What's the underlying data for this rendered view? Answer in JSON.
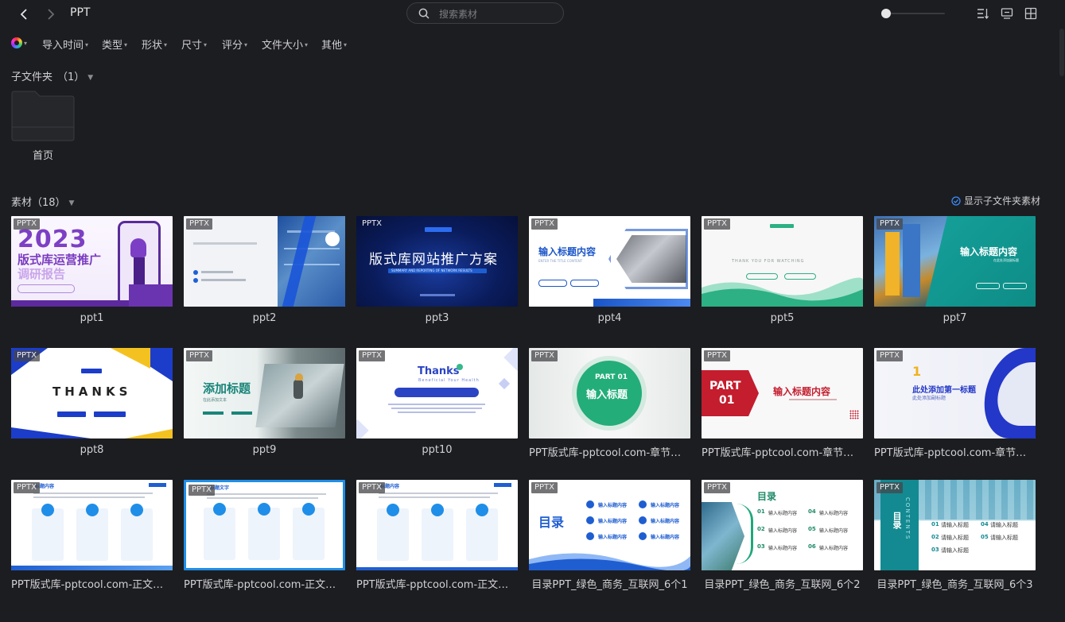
{
  "header": {
    "title": "PPT",
    "search_placeholder": "搜索素材"
  },
  "filters": [
    {
      "label": "导入时间"
    },
    {
      "label": "类型"
    },
    {
      "label": "形状"
    },
    {
      "label": "尺寸"
    },
    {
      "label": "评分"
    },
    {
      "label": "文件大小"
    },
    {
      "label": "其他"
    }
  ],
  "subfolders": {
    "heading": "子文件夹",
    "count": "（1）",
    "items": [
      {
        "label": "首页"
      }
    ]
  },
  "assets": {
    "heading": "素材（18）",
    "show_subfolder_label": "显示子文件夹素材",
    "badge": "PPTX",
    "items": [
      {
        "label": "ppt1"
      },
      {
        "label": "ppt2"
      },
      {
        "label": "ppt3"
      },
      {
        "label": "ppt4"
      },
      {
        "label": "ppt5"
      },
      {
        "label": "ppt7"
      },
      {
        "label": "ppt8"
      },
      {
        "label": "ppt9"
      },
      {
        "label": "ppt10"
      },
      {
        "label": "PPT版式库-pptcool.com-章节页-..."
      },
      {
        "label": "PPT版式库-pptcool.com-章节页-..."
      },
      {
        "label": "PPT版式库-pptcool.com-章节页-..."
      },
      {
        "label": "PPT版式库-pptcool.com-正文页-..."
      },
      {
        "label": "PPT版式库-pptcool.com-正文页-..."
      },
      {
        "label": "PPT版式库-pptcool.com-正文页-..."
      },
      {
        "label": "目录PPT_绿色_商务_互联网_6个1"
      },
      {
        "label": "目录PPT_绿色_商务_互联网_6个2"
      },
      {
        "label": "目录PPT_绿色_商务_互联网_6个3"
      }
    ]
  },
  "thumb_text": {
    "t1": {
      "year": "2023",
      "title": "版式库运营推广",
      "subtitle": "调研报告"
    },
    "t3": {
      "title": "版式库网站推广方案",
      "sub": "SUMMARY AND REPORTING OF NETWORK RESULTS"
    },
    "t4": {
      "title": "输入标题内容",
      "sub": "ENTER THE TITLE CONTENT"
    },
    "t5": {
      "sub": "THANK YOU FOR WATCHING"
    },
    "t7": {
      "title": "输入标题内容",
      "sub": "在此处添加副标题"
    },
    "t8": {
      "title": "THANKS"
    },
    "t9": {
      "title": "添加标题",
      "sub": "在此添加文本"
    },
    "t10": {
      "title": "Thanks",
      "sub": "Beneficial Your Health"
    },
    "t11": {
      "part": "PART 01",
      "title": "输入标题"
    },
    "t12": {
      "part": "PART",
      "num": "01",
      "title": "输入标题内容"
    },
    "t13": {
      "num": "1",
      "title": "此处添加第一标题",
      "sub": "此处添加副标题"
    },
    "t14": {
      "head": "标题内容"
    },
    "t15": {
      "head": "标题文字"
    },
    "t16": {
      "head": "标题内容"
    },
    "t17": {
      "title": "目录",
      "item": "输入标题内容"
    },
    "t18": {
      "title": "目录",
      "item": "输入标题内容"
    },
    "t19": {
      "title": "目录",
      "side": "CONTENTS",
      "item": "请输入标题"
    }
  },
  "colors": {
    "background": "#1c1d20",
    "text": "#d6d6d8",
    "badge": "#46464a",
    "accent": "#3b8cff"
  }
}
